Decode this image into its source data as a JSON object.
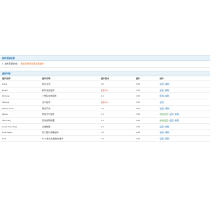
{
  "status_panel": {
    "title": "插件安装检测",
    "label": "插件安装状态：",
    "value": "您的系统已安装全部插件"
  },
  "list_panel": {
    "title": "插件列表",
    "columns": [
      "插件名称",
      "插件说明",
      "插件版本",
      "插件",
      "操作"
    ]
  },
  "plugins": [
    {
      "name": "index",
      "desc": "前台主页",
      "version": "2.0",
      "type": "1.0K",
      "actions": [
        "设置",
        "编辑"
      ],
      "warn": false,
      "green": false
    },
    {
      "name": "Email",
      "desc": "邮件发送插件",
      "version": "最新2.0",
      "type": "1.0K",
      "actions": [
        "设置",
        "编辑"
      ],
      "warn": true,
      "green": false
    },
    {
      "name": "QrCode",
      "desc": "二维码生成插件",
      "version": "2.1",
      "type": "1.0K",
      "actions": [
        "卸载",
        "编辑"
      ],
      "warn": false,
      "green": false
    },
    {
      "name": "Sample",
      "desc": "演示插件",
      "version": "最新2.0",
      "type": "1.0K",
      "actions": [
        "设置"
      ],
      "warn": true,
      "green": false
    },
    {
      "name": "Rssrss Time",
      "desc": "服务开关",
      "version": "1.0",
      "type": "1.0K",
      "actions": [
        "设置",
        "编辑"
      ],
      "warn": false,
      "green": false
    },
    {
      "name": "Alipay",
      "desc": "微信支付插件",
      "version": "2.1",
      "type": "1.0K",
      "actions": [
        "启动设置",
        "设置",
        "编辑"
      ],
      "warn": false,
      "green": true
    },
    {
      "name": "Summary",
      "desc": "自动提取摘要",
      "version": "2.1",
      "type": "1.0K",
      "actions": [
        "启动设置",
        "设置",
        "编辑"
      ],
      "warn": false,
      "green": true
    },
    {
      "name": "Load Time Data",
      "desc": "文章数据",
      "version": "1.0",
      "type": "1.0K",
      "actions": [
        "设置",
        "编辑"
      ],
      "warn": false,
      "green": false
    },
    {
      "name": "Hotimages",
      "desc": "热门图片缩略插件",
      "version": "1.0",
      "type": "1.0K",
      "actions": [
        "设置",
        "编辑"
      ],
      "warn": false,
      "green": false
    },
    {
      "name": "Note",
      "desc": "Note格式文章发布插件",
      "version": "1.0",
      "type": "1.0K",
      "actions": [
        "设置",
        "编辑"
      ],
      "warn": false,
      "green": false
    }
  ]
}
